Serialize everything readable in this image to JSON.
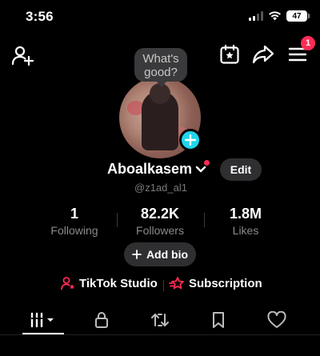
{
  "status_bar": {
    "time": "3:56",
    "battery": "47",
    "icons": [
      "signal-icon",
      "wifi-icon",
      "battery-icon"
    ]
  },
  "top_nav": {
    "icons": [
      "add-friend-icon",
      "calendar-star-icon",
      "share-icon",
      "menu-icon"
    ],
    "menu_badge": "1"
  },
  "profile": {
    "bubble_text": "What's good?",
    "username": "Aboalkasem",
    "handle": "@z1ad_al1",
    "edit_label": "Edit"
  },
  "stats": {
    "following": {
      "value": "1",
      "label": "Following"
    },
    "followers": {
      "value": "82.2K",
      "label": "Followers"
    },
    "likes": {
      "value": "1.8M",
      "label": "Likes"
    }
  },
  "add_bio_label": "Add bio",
  "links": {
    "studio_label": "TikTok Studio",
    "subscription_label": "Subscription"
  },
  "tabs": [
    "videos-grid-icon",
    "lock-icon",
    "repost-icon",
    "bookmark-icon",
    "heart-icon"
  ],
  "colors": {
    "accent_red": "#fe2c55",
    "add_blue": "#20d5ec",
    "chip_bg": "#2f2f31"
  }
}
